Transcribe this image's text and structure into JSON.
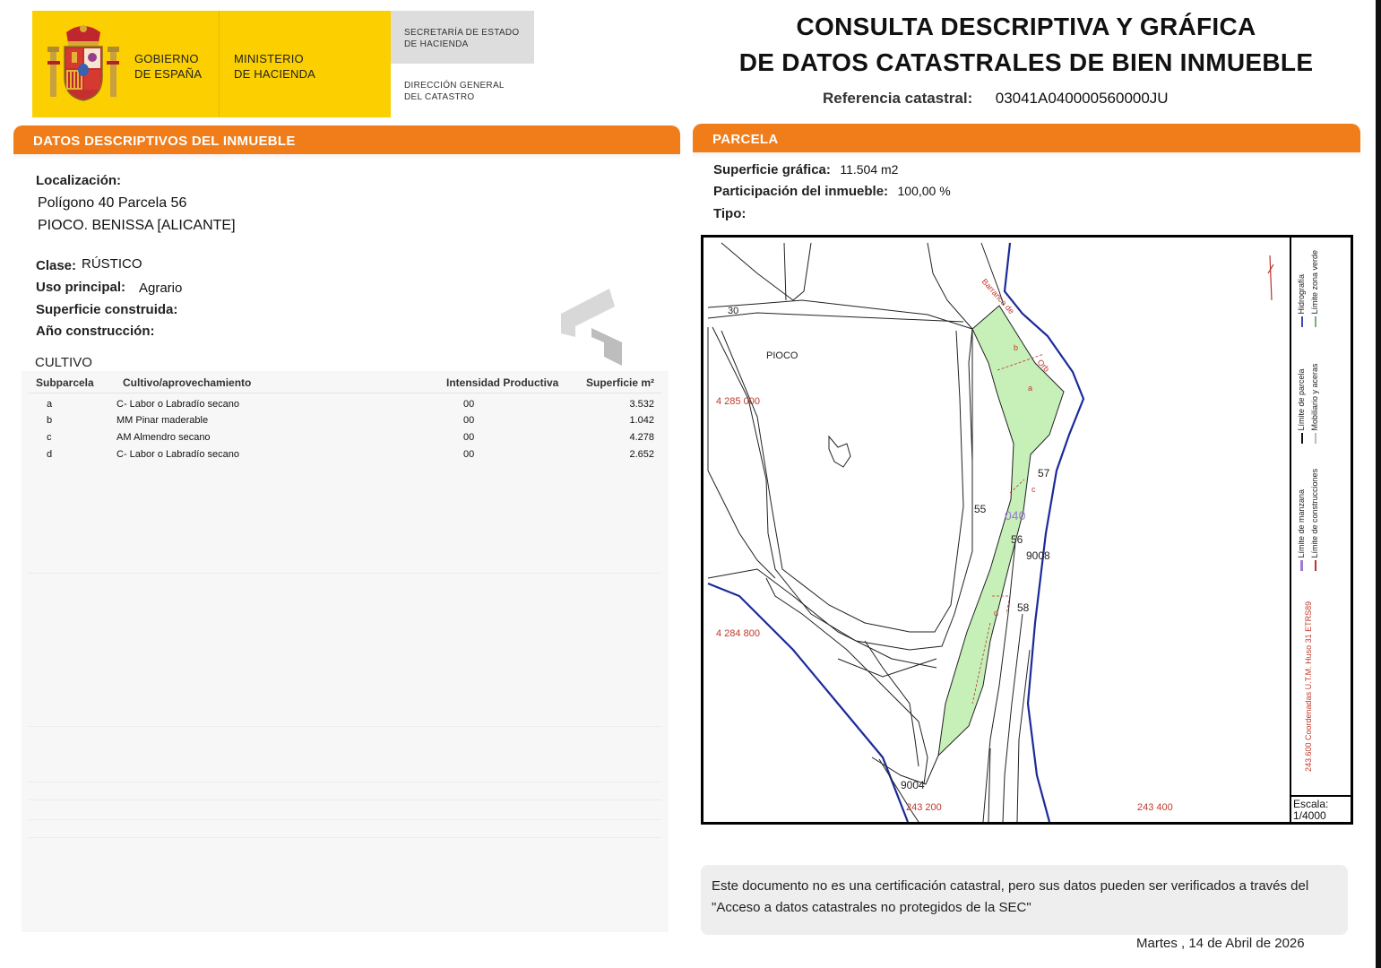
{
  "header": {
    "gov_line1": "GOBIERNO",
    "gov_line2": "DE ESPAÑA",
    "min_line1": "MINISTERIO",
    "min_line2": "DE HACIENDA",
    "sec_line1": "SECRETARÍA DE ESTADO",
    "sec_line2": "DE HACIENDA",
    "dir_line1": "DIRECCIÓN GENERAL",
    "dir_line2": "DEL CATASTRO",
    "emblem_icon": "coat-of-arms-icon"
  },
  "title": {
    "line1": "CONSULTA DESCRIPTIVA Y GRÁFICA",
    "line2": "DE DATOS CATASTRALES DE BIEN INMUEBLE",
    "ref_label": "Referencia catastral:",
    "ref_value": "03041A040000560000JU"
  },
  "descriptivos": {
    "header": "DATOS DESCRIPTIVOS DEL INMUEBLE",
    "localizacion_label": "Localización:",
    "localizacion_line1": "Polígono 40 Parcela 56",
    "localizacion_line2": "PIOCO. BENISSA [ALICANTE]",
    "clase_label": "Clase:",
    "clase_value": "RÚSTICO",
    "uso_label": "Uso principal:",
    "uso_value": "Agrario",
    "superficie_label": "Superficie construida:",
    "anio_label": "Año construcción:"
  },
  "cultivo": {
    "title": "CULTIVO",
    "columns": [
      "Subparcela",
      "Cultivo/aprovechamiento",
      "Intensidad Productiva",
      "Superficie m²"
    ],
    "rows": [
      {
        "sub": "a",
        "cultivo": "C- Labor o Labradío secano",
        "intensidad": "00",
        "superficie": "3.532"
      },
      {
        "sub": "b",
        "cultivo": "MM Pinar maderable",
        "intensidad": "00",
        "superficie": "1.042"
      },
      {
        "sub": "c",
        "cultivo": "AM Almendro secano",
        "intensidad": "00",
        "superficie": "4.278"
      },
      {
        "sub": "d",
        "cultivo": "C- Labor o Labradío secano",
        "intensidad": "00",
        "superficie": "2.652"
      }
    ]
  },
  "parcela": {
    "header": "PARCELA",
    "superficie_label": "Superficie gráfica:",
    "superficie_value": "11.504 m2",
    "participacion_label": "Participación del inmueble:",
    "participacion_value": "100,00 %",
    "tipo_label": "Tipo:"
  },
  "map": {
    "labels": {
      "pioco": "PIOCO",
      "n30": "30",
      "coord_4285000": "4 285 000",
      "coord_4284800": "4 284 800",
      "coord_243200": "243 200",
      "coord_243400": "243 400",
      "n55": "55",
      "n57": "57",
      "n56": "56",
      "n58": "58",
      "n040": "040",
      "n9008": "9008",
      "n9004": "9004",
      "sub_a": "a",
      "sub_b": "b",
      "sub_c": "c",
      "sub_d": "d",
      "barranco": "Barranco de",
      "orb": "Orb"
    },
    "legend": {
      "hidrografia": "Hidrografía",
      "limite_zona_verde": "Límite zona verde",
      "limite_parcela": "Límite de parcela",
      "mobiliario": "Mobiliario y aceras",
      "limite_manzana": "Límite de manzana",
      "limite_construcciones": "Límite de construcciones",
      "coordenadas": "243.600 Coordenadas U.T.M. Huso 31 ETRS89",
      "escala_label": "Escala:",
      "escala_value": "1/4000"
    },
    "colors": {
      "parcel_fill": "#c6f0b8",
      "hydro": "#1a2a9a",
      "coords": "#c0392b",
      "parcel_label": "#9b7bd4"
    }
  },
  "footer": {
    "disclaimer": "Este documento no es una certificación catastral, pero sus datos pueden ser verificados a través del \"Acceso a datos catastrales no protegidos de la SEC\"",
    "date": "Martes , 14 de Abril de 2026"
  }
}
